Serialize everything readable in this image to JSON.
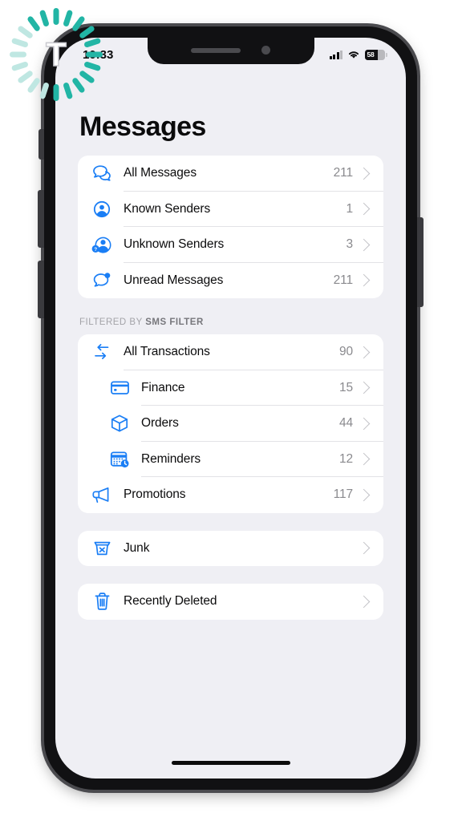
{
  "status_bar": {
    "time": "10:33",
    "signal_icon": "cellular-signal-icon",
    "wifi_icon": "wifi-icon",
    "battery_percent": "58",
    "battery_icon": "battery-icon"
  },
  "header": {
    "title": "Messages"
  },
  "overlay": {
    "spinner_letter": "T",
    "spinner_color": "#22b5a5"
  },
  "colors": {
    "accent": "#1a7ef5",
    "screen_bg": "#efeff4",
    "card_bg": "#ffffff",
    "secondary_text": "#8a8a8e"
  },
  "sections": [
    {
      "name": "mailboxes",
      "header": null,
      "rows": [
        {
          "icon": "two-chat-bubbles-icon",
          "label": "All Messages",
          "count": "211",
          "indent": false,
          "chevron": "chevron-right-icon"
        },
        {
          "icon": "person-circle-icon",
          "label": "Known Senders",
          "count": "1",
          "indent": false,
          "chevron": "chevron-right-icon"
        },
        {
          "icon": "person-question-icon",
          "label": "Unknown Senders",
          "count": "3",
          "indent": false,
          "chevron": "chevron-right-icon"
        },
        {
          "icon": "chat-bubble-badge-icon",
          "label": "Unread Messages",
          "count": "211",
          "indent": false,
          "chevron": "chevron-right-icon"
        }
      ]
    },
    {
      "name": "sms-filter",
      "header": {
        "prefix": "FILTERED BY ",
        "strong": "SMS FILTER"
      },
      "rows": [
        {
          "icon": "transactions-arrows-icon",
          "label": "All Transactions",
          "count": "90",
          "indent": false,
          "chevron": "chevron-right-icon"
        },
        {
          "icon": "credit-card-icon",
          "label": "Finance",
          "count": "15",
          "indent": true,
          "chevron": "chevron-right-icon"
        },
        {
          "icon": "package-box-icon",
          "label": "Orders",
          "count": "44",
          "indent": true,
          "chevron": "chevron-right-icon"
        },
        {
          "icon": "calendar-clock-icon",
          "label": "Reminders",
          "count": "12",
          "indent": true,
          "chevron": "chevron-right-icon"
        },
        {
          "icon": "megaphone-icon",
          "label": "Promotions",
          "count": "117",
          "indent": false,
          "chevron": "chevron-right-icon"
        }
      ]
    },
    {
      "name": "junk",
      "header": null,
      "rows": [
        {
          "icon": "junk-bin-icon",
          "label": "Junk",
          "count": "",
          "indent": false,
          "chevron": "chevron-right-icon"
        }
      ]
    },
    {
      "name": "recently-deleted",
      "header": null,
      "rows": [
        {
          "icon": "trash-icon",
          "label": "Recently Deleted",
          "count": "",
          "indent": false,
          "chevron": "chevron-right-icon"
        }
      ]
    }
  ]
}
